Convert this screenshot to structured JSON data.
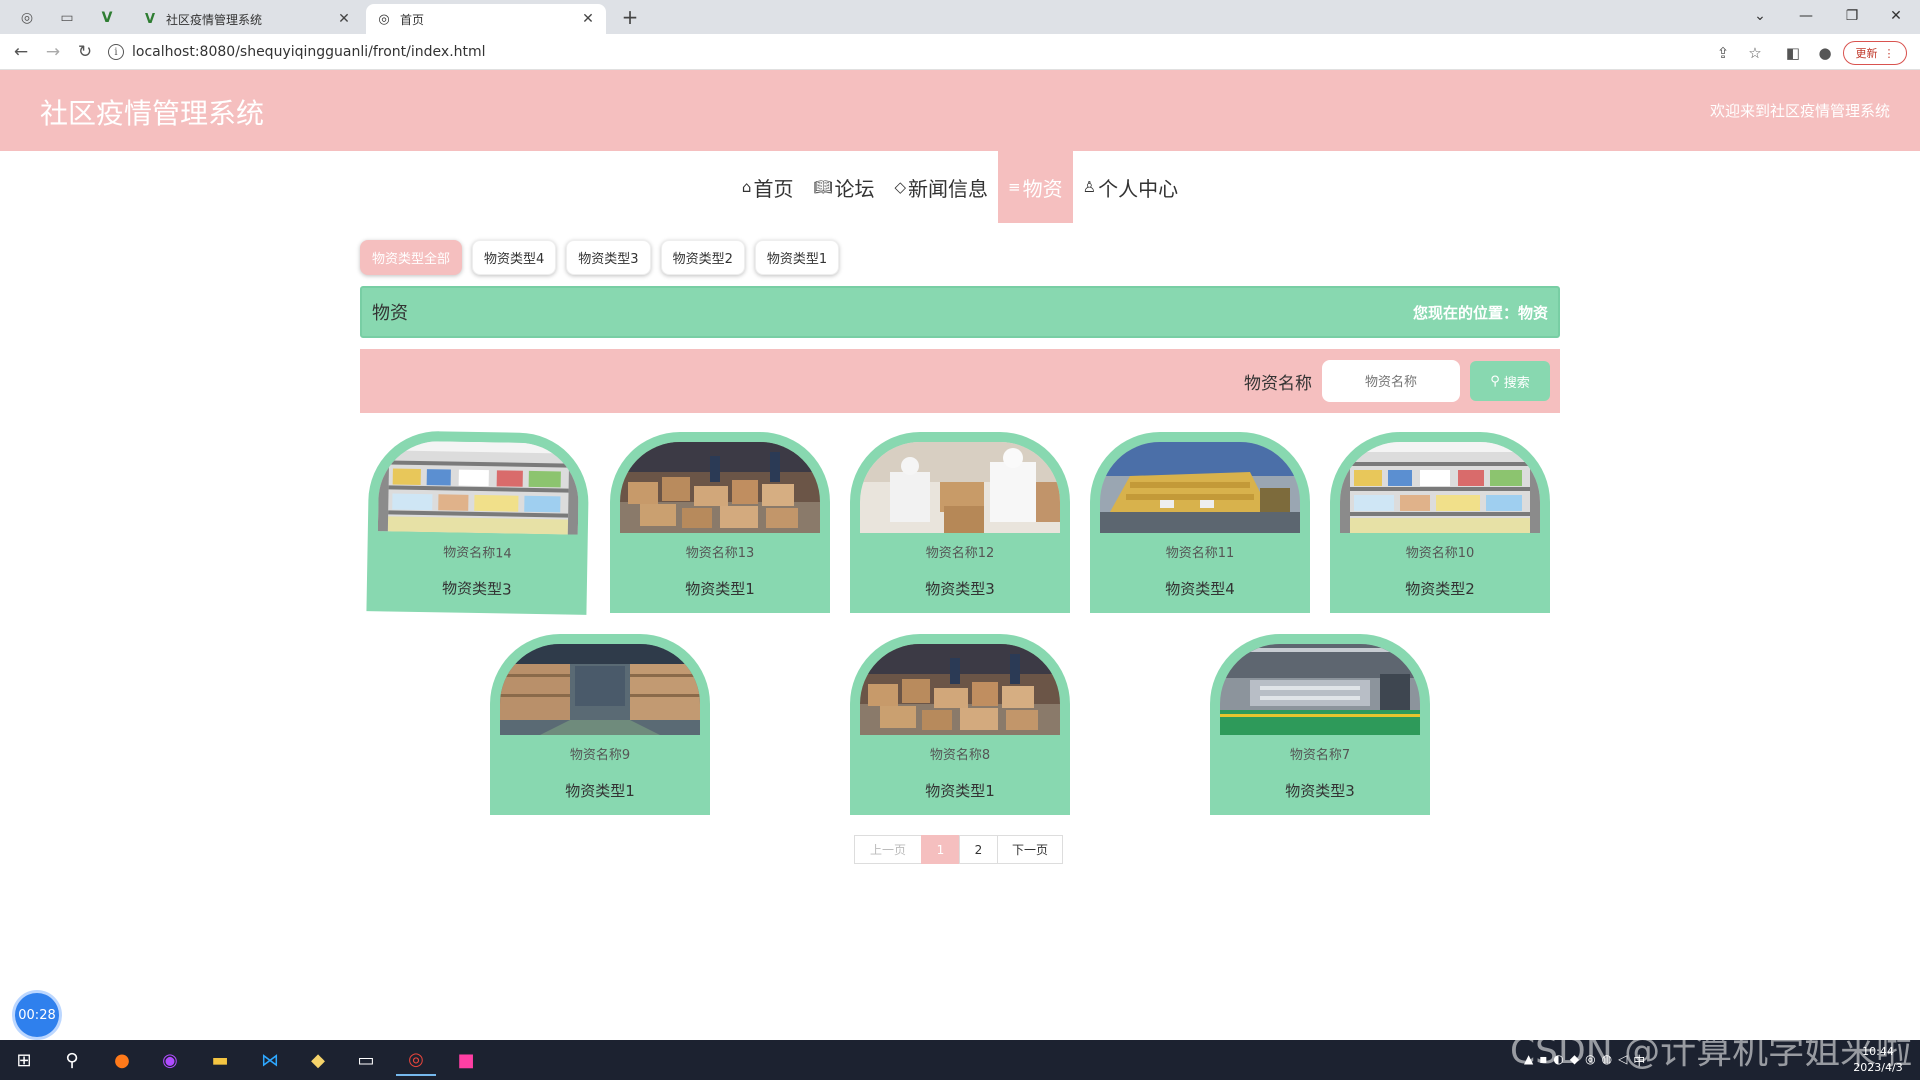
{
  "browser": {
    "tabs": [
      {
        "title": "社区疫情管理系统",
        "icon": "vue-logo-icon"
      },
      {
        "title": "首页",
        "icon": "globe-icon"
      }
    ],
    "url": "localhost:8080/shequyiqingguanli/front/index.html",
    "update_label": "更新"
  },
  "header": {
    "title": "社区疫情管理系统",
    "welcome": "欢迎来到社区疫情管理系统"
  },
  "nav": [
    {
      "label": "首页",
      "icon": "home-icon"
    },
    {
      "label": "论坛",
      "icon": "book-icon"
    },
    {
      "label": "新闻信息",
      "icon": "tag-icon"
    },
    {
      "label": "物资",
      "icon": "list-icon",
      "active": true
    },
    {
      "label": "个人中心",
      "icon": "user-icon"
    }
  ],
  "categories": [
    "物资类型全部",
    "物资类型4",
    "物资类型3",
    "物资类型2",
    "物资类型1"
  ],
  "breadcrumb": {
    "title": "物资",
    "position": "您现在的位置：物资"
  },
  "search": {
    "label": "物资名称",
    "placeholder": "物资名称",
    "button": "搜索"
  },
  "items": [
    {
      "name": "物资名称14",
      "type": "物资类型3",
      "photo": "shelves"
    },
    {
      "name": "物资名称13",
      "type": "物资类型1",
      "photo": "boxes"
    },
    {
      "name": "物资名称12",
      "type": "物资类型3",
      "photo": "workers"
    },
    {
      "name": "物资名称11",
      "type": "物资类型4",
      "photo": "pallets"
    },
    {
      "name": "物资名称10",
      "type": "物资类型2",
      "photo": "shelves"
    },
    {
      "name": "物资名称9",
      "type": "物资类型1",
      "photo": "warehouse"
    },
    {
      "name": "物资名称8",
      "type": "物资类型1",
      "photo": "boxes"
    },
    {
      "name": "物资名称7",
      "type": "物资类型3",
      "photo": "factory"
    }
  ],
  "pagination": {
    "prev": "上一页",
    "pages": [
      "1",
      "2"
    ],
    "current": "1",
    "next": "下一页"
  },
  "timer": "00:28",
  "taskbar": {
    "clock_time": "10:44",
    "clock_date": "2023/4/3",
    "ime": "中"
  },
  "watermark": "CSDN @计算机学姐来啦",
  "colors": {
    "pink": "#f5bfbf",
    "mint": "#88d8b0"
  }
}
